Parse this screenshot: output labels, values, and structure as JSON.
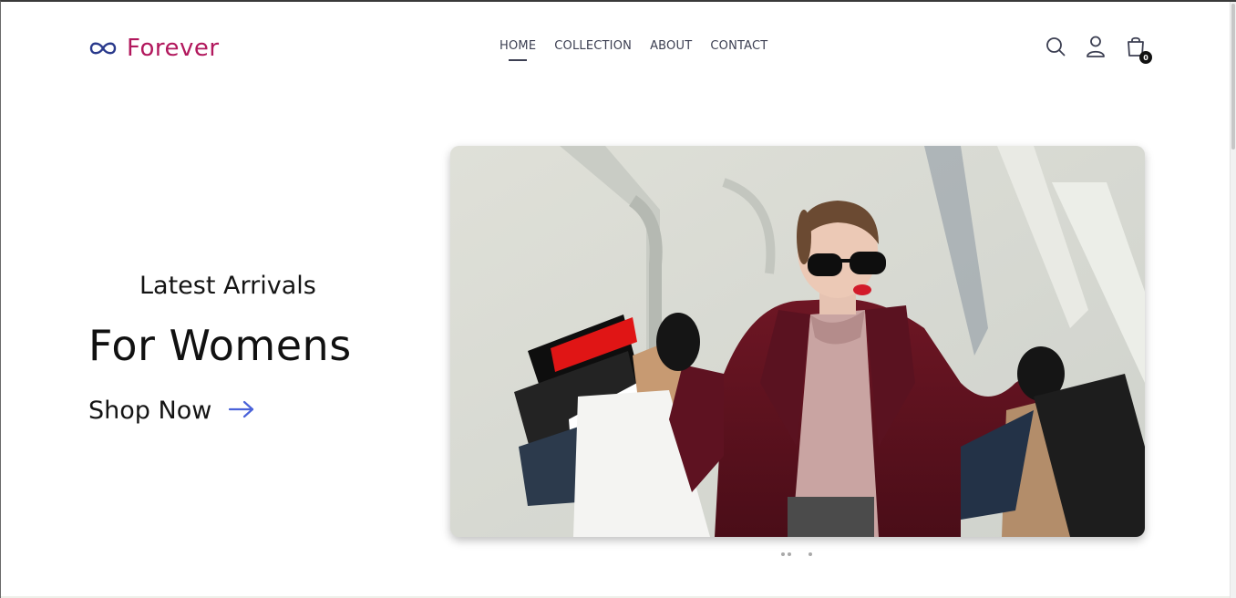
{
  "brand": {
    "name": "Forever",
    "color": "#b2185d",
    "icon": "infinity-icon",
    "icon_color": "#2a3a8c"
  },
  "nav": {
    "items": [
      {
        "label": "HOME",
        "active": true
      },
      {
        "label": "COLLECTION",
        "active": false
      },
      {
        "label": "ABOUT",
        "active": false
      },
      {
        "label": "CONTACT",
        "active": false
      }
    ]
  },
  "header_icons": {
    "search": "search-icon",
    "profile": "user-icon",
    "cart": "shopping-bag-icon",
    "cart_count": "0"
  },
  "hero": {
    "kicker": "Latest Arrivals",
    "title": "For Womens",
    "cta_label": "Shop Now",
    "cta_icon": "arrow-right-icon",
    "cta_icon_color": "#4a62d9",
    "image": "woman-with-shopping-bags-photo"
  },
  "carousel": {
    "slide_count": 3
  }
}
